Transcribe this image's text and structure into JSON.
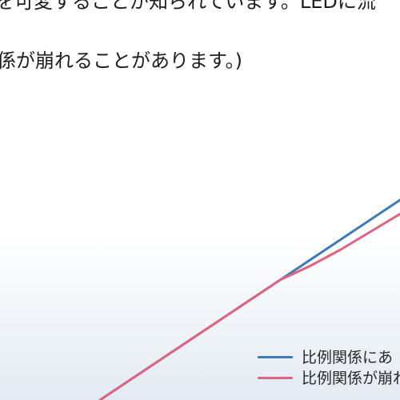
{
  "text": {
    "line1": "を可変することが知られています。LEDに流",
    "line2": "係が崩れることがあります。)"
  },
  "chart_data": {
    "type": "line",
    "grid": false,
    "legend": "bottom-right",
    "series": [
      {
        "name": "比例関係にあ",
        "color": "#3d7bb6",
        "x": [
          0,
          10
        ],
        "y": [
          0,
          10
        ]
      },
      {
        "name": "比例関係が崩れ",
        "color": "#e0647f",
        "x": [
          0,
          2,
          4,
          6,
          7,
          8,
          9,
          10
        ],
        "y": [
          0,
          2,
          4,
          6,
          6.7,
          7.5,
          8.4,
          9.3
        ]
      }
    ]
  }
}
